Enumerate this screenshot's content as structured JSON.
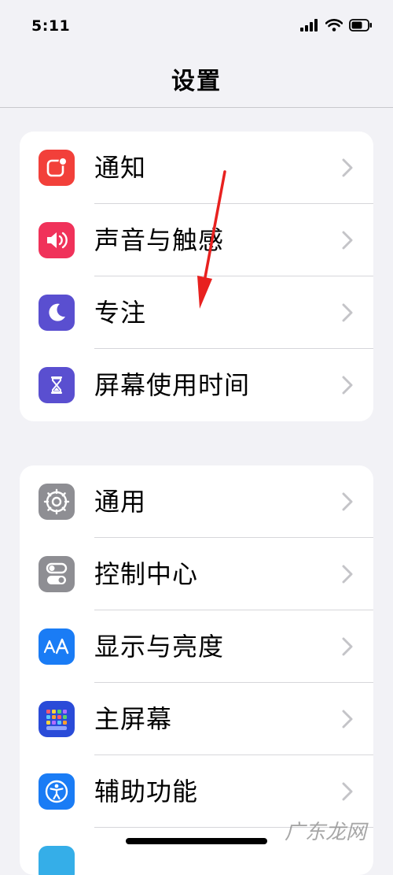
{
  "status_bar": {
    "time": "5:11"
  },
  "nav": {
    "title": "设置"
  },
  "groups": [
    {
      "items": [
        {
          "label": "通知",
          "icon": "notifications-icon",
          "color": "#f2403a"
        },
        {
          "label": "声音与触感",
          "icon": "speaker-icon",
          "color": "#f0325a"
        },
        {
          "label": "专注",
          "icon": "moon-icon",
          "color": "#5a4fd0"
        },
        {
          "label": "屏幕使用时间",
          "icon": "hourglass-icon",
          "color": "#5a4fd0"
        }
      ]
    },
    {
      "items": [
        {
          "label": "通用",
          "icon": "gear-icon",
          "color": "#8e8e93"
        },
        {
          "label": "控制中心",
          "icon": "toggles-icon",
          "color": "#8e8e93"
        },
        {
          "label": "显示与亮度",
          "icon": "text-size-icon",
          "color": "#1a7cf5"
        },
        {
          "label": "主屏幕",
          "icon": "home-grid-icon",
          "color": "#2a4bd8"
        },
        {
          "label": "辅助功能",
          "icon": "accessibility-icon",
          "color": "#1a7cf5"
        }
      ]
    }
  ],
  "watermark": "广东龙网",
  "colors": {
    "background": "#f2f2f6",
    "annotation_arrow": "#e8211f"
  }
}
